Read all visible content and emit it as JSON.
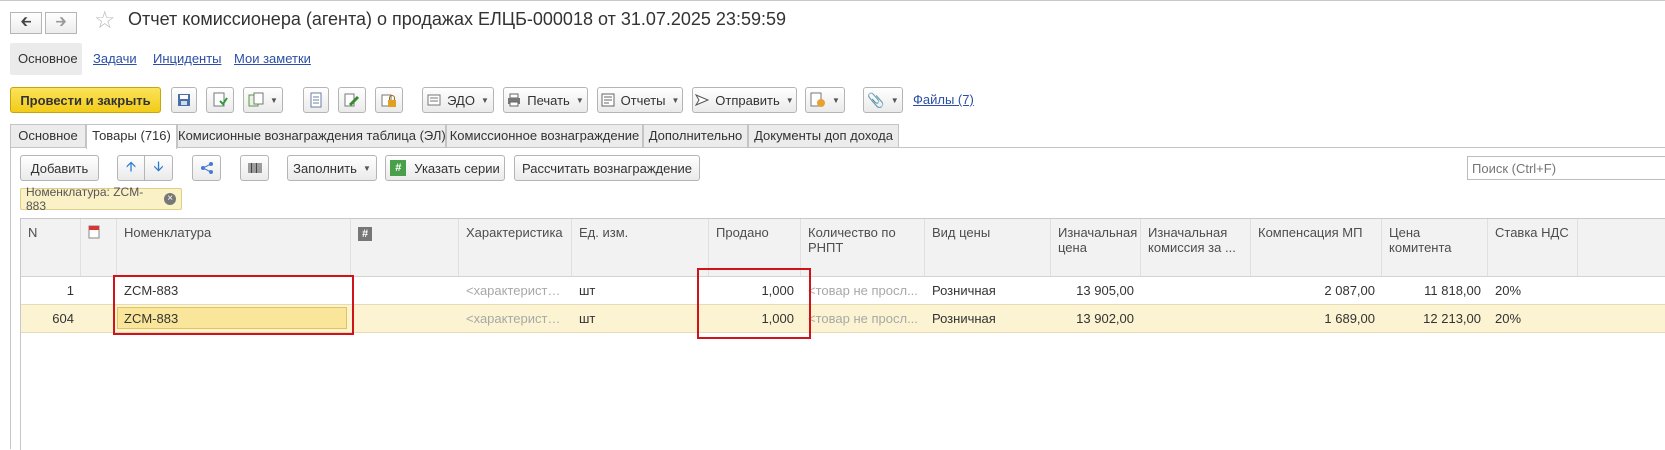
{
  "window": {
    "title": "Отчет комиссионера (агента) о продажах ЕЛЦБ-000018 от 31.07.2025 23:59:59"
  },
  "subtabs": [
    "Основное",
    "Задачи",
    "Инциденты",
    "Мои заметки"
  ],
  "toolbar": {
    "post_close": "Провести и закрыть",
    "edo": "ЭДО",
    "print": "Печать",
    "reports": "Отчеты",
    "send": "Отправить",
    "files": "Файлы (7)"
  },
  "tabs": [
    "Основное",
    "Товары (716)",
    "Комисионные вознаграждения таблица (ЭЛ)",
    "Комиссионное вознаграждение",
    "Дополнительно",
    "Документы доп дохода"
  ],
  "goods_toolbar": {
    "add": "Добавить",
    "fill": "Заполнить",
    "series": "Указать серии",
    "calc": "Рассчитать вознаграждение",
    "search_placeholder": "Поиск (Ctrl+F)"
  },
  "filter": {
    "label": "Номенклатура: ZCM-883"
  },
  "table": {
    "columns": {
      "n": "N",
      "nomenclature": "Номенклатура",
      "hash": "#",
      "characteristic": "Характеристика",
      "unit": "Ед. изм.",
      "sold": "Продано",
      "qty_rnpt": "Количество по РНПТ",
      "price_type": "Вид цены",
      "initial_price": "Изначальная цена",
      "initial_commission": "Изначальная комиссия за ...",
      "compensation": "Компенсация МП",
      "principal_price": "Цена комитента",
      "vat_rate": "Ставка НДС"
    },
    "rows": [
      {
        "n": "1",
        "nomenclature": "ZCM-883",
        "characteristic": "<характеристи...",
        "unit": "шт",
        "sold": "1,000",
        "qty_rnpt": "<товар не просл...",
        "price_type": "Розничная",
        "initial_price": "13 905,00",
        "initial_commission": "",
        "compensation": "2 087,00",
        "principal_price": "11 818,00",
        "vat_rate": "20%"
      },
      {
        "n": "604",
        "nomenclature": "ZCM-883",
        "characteristic": "<характеристи...",
        "unit": "шт",
        "sold": "1,000",
        "qty_rnpt": "<товар не просл...",
        "price_type": "Розничная",
        "initial_price": "13 902,00",
        "initial_commission": "",
        "compensation": "1 689,00",
        "principal_price": "12 213,00",
        "vat_rate": "20%"
      }
    ]
  }
}
